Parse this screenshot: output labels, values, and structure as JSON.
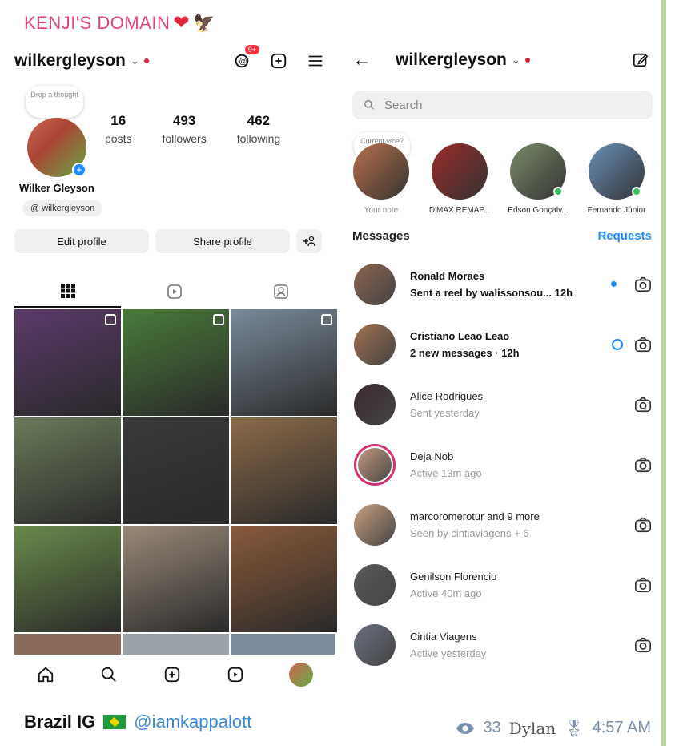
{
  "banner": {
    "text": "KENJI'S DOMAIN",
    "heart": "❤️",
    "eagle": "🦅"
  },
  "profile": {
    "username": "wilkergleyson",
    "notif_badge": "9+",
    "thought_text": "Drop a thought",
    "stats": [
      {
        "num": "16",
        "label": "posts"
      },
      {
        "num": "493",
        "label": "followers"
      },
      {
        "num": "462",
        "label": "following"
      }
    ],
    "full_name": "Wilker Gleyson",
    "threads_handle": "wilkergleyson",
    "edit_label": "Edit profile",
    "share_label": "Share profile",
    "add_person_label": "+♂"
  },
  "dm": {
    "username": "wilkergleyson",
    "search_placeholder": "Search",
    "notes": [
      {
        "bubble": "Current vibe?",
        "label": "Your note",
        "muted": true,
        "online": false,
        "color": "#b8704a"
      },
      {
        "bubble": "",
        "label": "D'MAX REMAP...",
        "muted": false,
        "online": false,
        "color": "#9a2a2a"
      },
      {
        "bubble": "",
        "label": "Edson Gonçalv...",
        "muted": false,
        "online": true,
        "color": "#7b8a6a"
      },
      {
        "bubble": "",
        "label": "Fernando Júnior",
        "muted": false,
        "online": true,
        "color": "#6a8fb8"
      }
    ],
    "messages_title": "Messages",
    "requests_label": "Requests",
    "conversations": [
      {
        "name": "Ronald Moraes",
        "sub": "Sent a reel by walissonsou...  12h",
        "unread": true,
        "indicator": "dot",
        "color": "#8a6450",
        "ring": false
      },
      {
        "name": "Cristiano Leao Leao",
        "sub": "2 new messages · 12h",
        "unread": true,
        "indicator": "ring",
        "color": "#a07050",
        "ring": false
      },
      {
        "name": "Alice Rodrigues",
        "sub": "Sent yesterday",
        "unread": false,
        "indicator": "",
        "color": "#3a2a30",
        "ring": false
      },
      {
        "name": "Deja Nob",
        "sub": "Active 13m ago",
        "unread": false,
        "indicator": "",
        "color": "#c89a80",
        "ring": true
      },
      {
        "name": "marcoromerotur and 9 more",
        "sub": "Seen by cintiaviagens + 6",
        "unread": false,
        "indicator": "",
        "color": "#c8a080",
        "ring": false
      },
      {
        "name": "Genilson Florencio",
        "sub": "Active 40m ago",
        "unread": false,
        "indicator": "",
        "color": "#5a5a5a",
        "ring": false
      },
      {
        "name": "Cintia Viagens",
        "sub": "Active yesterday",
        "unread": false,
        "indicator": "",
        "color": "#6a7080",
        "ring": false
      }
    ]
  },
  "grid_colors": [
    "#5a3a6a",
    "#4a7a3a",
    "#7a8a9a",
    "#6a7a5a",
    "#3a3a3a",
    "#8a6a4a",
    "#6a8a4a",
    "#9a8a7a",
    "#8a5a3a"
  ],
  "partial_colors": [
    "#8a6a5a",
    "#9aa0a8",
    "#7a8a9a"
  ],
  "footer": {
    "brand": "Brazil IG",
    "handle": "@iamkappalott",
    "views": "33",
    "signature": "Dylan",
    "time": "4:57 AM"
  }
}
